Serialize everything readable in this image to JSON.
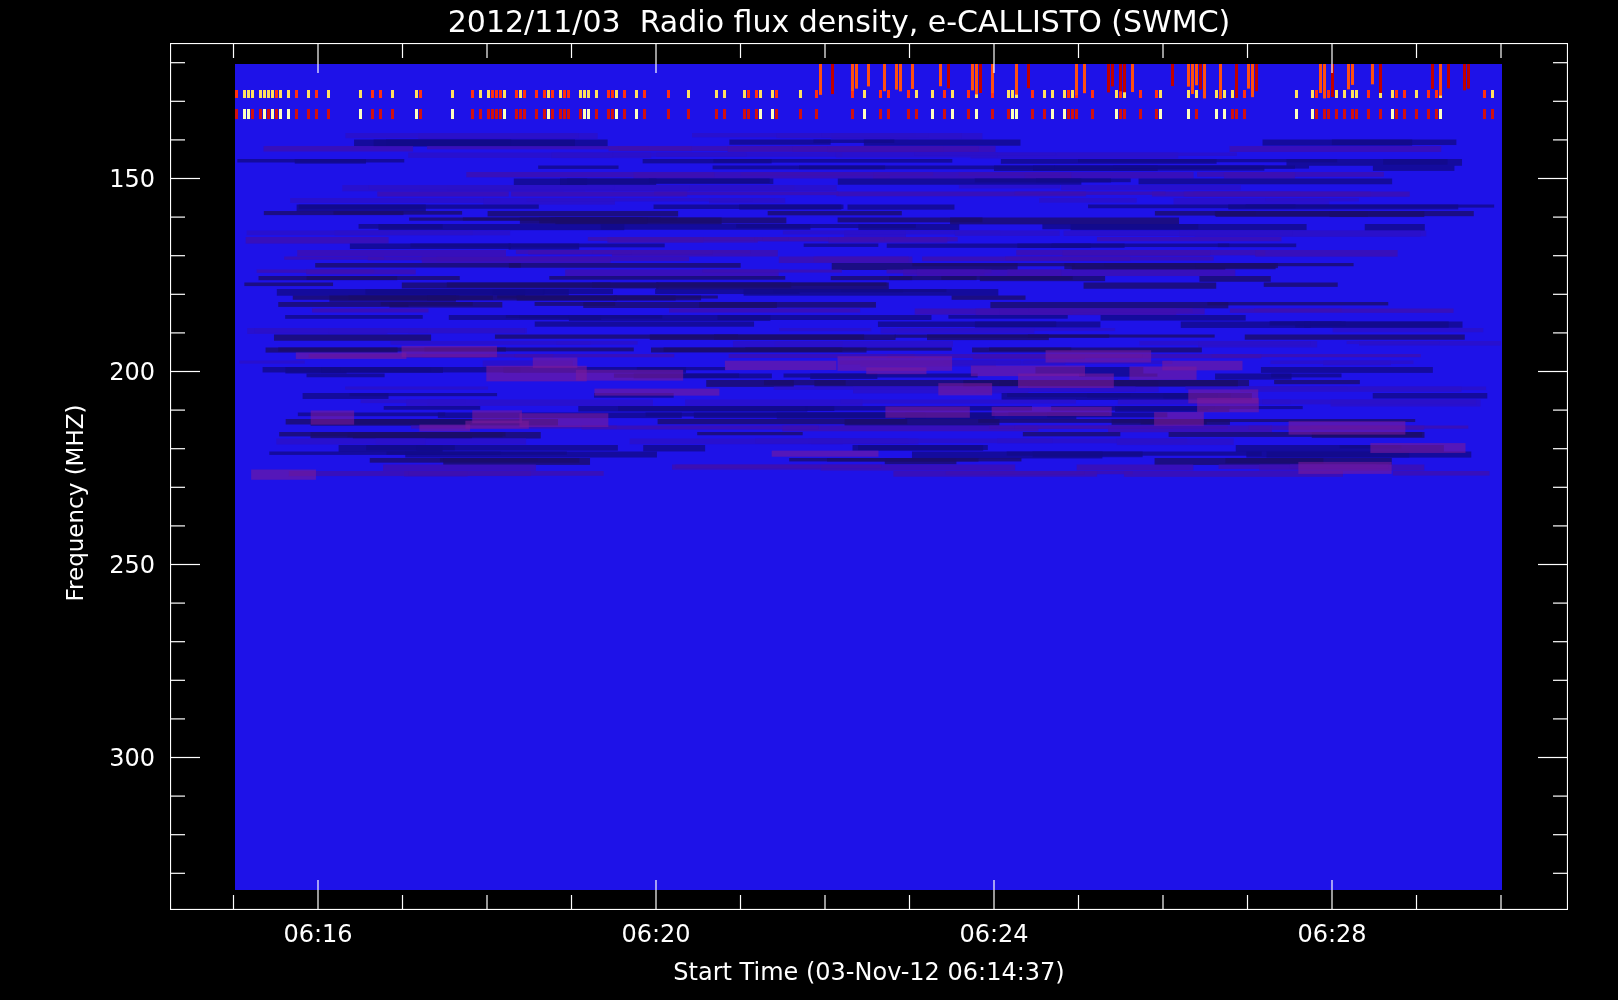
{
  "title": "2012/11/03  Radio flux density, e-CALLISTO (SWMC)",
  "y_axis": {
    "label": "Frequency (MHZ)",
    "ticks": [
      "150",
      "200",
      "250",
      "300"
    ]
  },
  "x_axis": {
    "label": "Start Time (03-Nov-12 06:14:37)",
    "ticks": [
      "06:16",
      "06:20",
      "06:24",
      "06:28"
    ]
  }
}
